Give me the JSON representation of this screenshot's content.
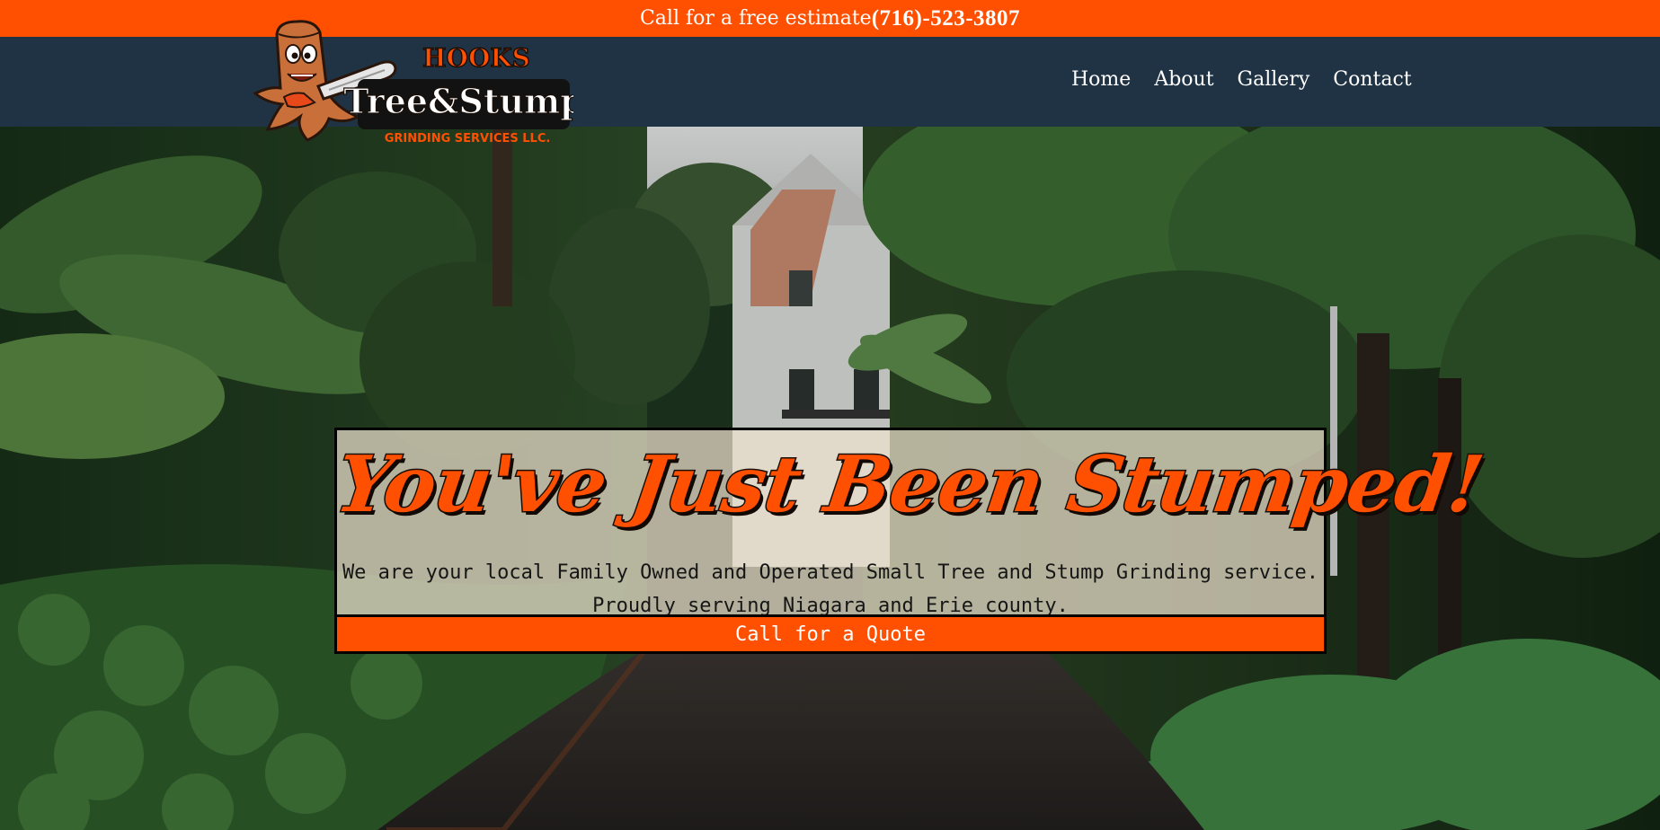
{
  "topbar": {
    "estimate_text": "Call for a free estimate",
    "phone": "(716)-523-3807"
  },
  "logo": {
    "top_word": "HOOKS",
    "main_word": "Tree&Stump",
    "sub_word": "GRINDING SERVICES LLC."
  },
  "nav": {
    "items": [
      {
        "label": "Home"
      },
      {
        "label": "About"
      },
      {
        "label": "Gallery"
      },
      {
        "label": "Contact"
      }
    ]
  },
  "hero": {
    "headline": "You've Just Been Stumped!",
    "description_line1": "We are your local Family Owned and Operated Small Tree and Stump Grinding service.",
    "description_line2": "Proudly serving Niagara and Erie county.",
    "button_label": "Call for a Quote"
  },
  "colors": {
    "accent": "#ff5001",
    "header_bg": "#1f3344",
    "card_bg": "#eee2cf"
  },
  "icons": {
    "logo_mascot": "stump-mascot-with-chainsaw"
  }
}
